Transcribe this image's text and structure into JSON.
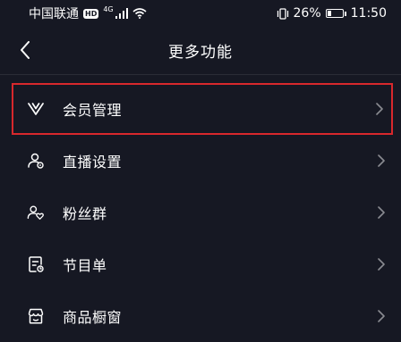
{
  "status_bar": {
    "carrier": "中国联通",
    "hd": "HD",
    "network": "4G",
    "battery_percent": "26%",
    "battery_level": 0.26,
    "time": "11:50"
  },
  "nav": {
    "title": "更多功能"
  },
  "menu": {
    "items": [
      {
        "label": "会员管理",
        "icon": "v-icon",
        "highlighted": true
      },
      {
        "label": "直播设置",
        "icon": "live-settings-icon"
      },
      {
        "label": "粉丝群",
        "icon": "fan-group-icon"
      },
      {
        "label": "节目单",
        "icon": "program-list-icon"
      },
      {
        "label": "商品橱窗",
        "icon": "shop-window-icon"
      }
    ]
  },
  "colors": {
    "background": "#161823",
    "highlight_border": "#d8282c",
    "text": "#ffffff",
    "chevron": "#8a8b91"
  }
}
